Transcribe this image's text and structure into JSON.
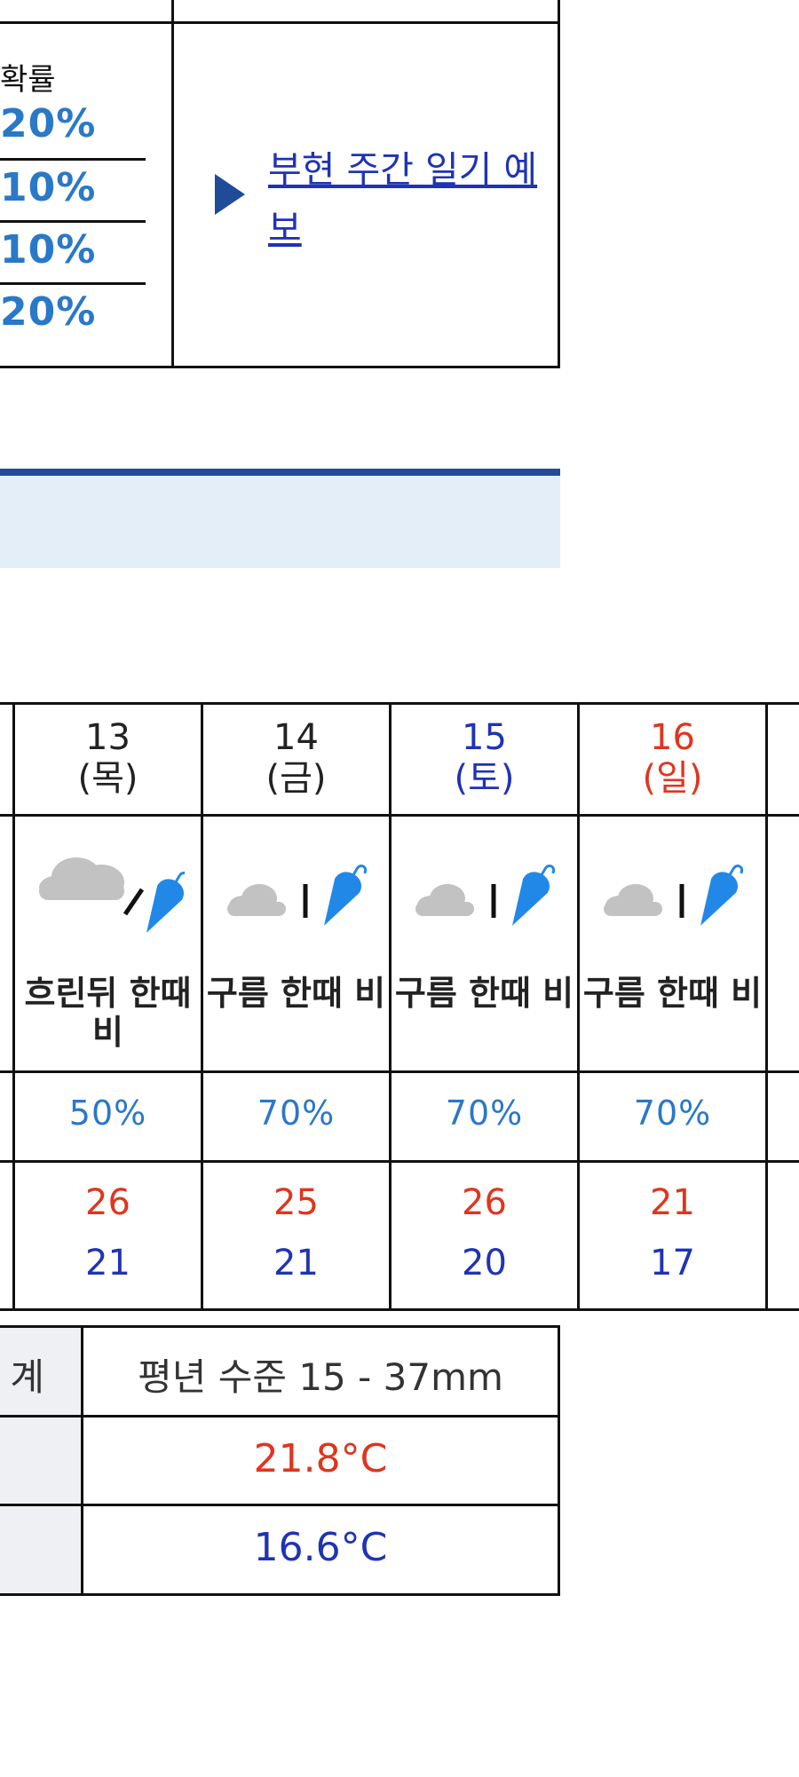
{
  "top_box": {
    "prob_label": "확률",
    "prob_values": [
      "20%",
      "10%",
      "10%",
      "20%"
    ],
    "weekly_link": "부현 주간 일기 예보"
  },
  "forecast": {
    "days": [
      {
        "date": "13",
        "weekday": "(목)",
        "weekday_type": "weekday",
        "icon": "cloudy-then-rain-icon",
        "desc": "흐린뒤 한때 비",
        "precip": "50%",
        "high": "26",
        "low": "21"
      },
      {
        "date": "14",
        "weekday": "(금)",
        "weekday_type": "weekday",
        "icon": "cloud-occasional-rain-icon",
        "desc": "구름 한때 비",
        "precip": "70%",
        "high": "25",
        "low": "21"
      },
      {
        "date": "15",
        "weekday": "(토)",
        "weekday_type": "saturday",
        "icon": "cloud-occasional-rain-icon",
        "desc": "구름 한때 비",
        "precip": "70%",
        "high": "26",
        "low": "20"
      },
      {
        "date": "16",
        "weekday": "(일)",
        "weekday_type": "sunday",
        "icon": "cloud-occasional-rain-icon",
        "desc": "구름 한때 비",
        "precip": "70%",
        "high": "21",
        "low": "17"
      }
    ],
    "colors": {
      "weekday": "#222222",
      "saturday": "#1f33b5",
      "sunday": "#e0351e"
    }
  },
  "normals": {
    "row1_label_partial": "계",
    "precip_normal": "평년 수준 15 - 37mm",
    "high_normal": "21.8°C",
    "low_normal": "16.6°C"
  }
}
